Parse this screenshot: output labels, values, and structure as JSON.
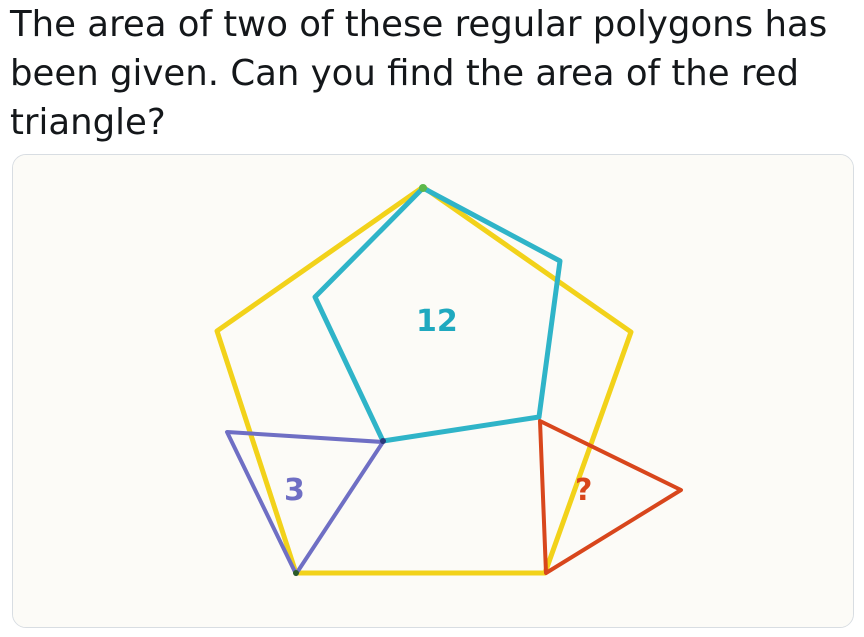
{
  "tweet": {
    "lines": [
      "The area of two of these regular polygons has",
      "been given. Can you find the area of the red",
      "triangle?"
    ]
  },
  "figure": {
    "labels": {
      "pentagon_area": "12",
      "blue_triangle_area": "3",
      "red_triangle_area": "?"
    },
    "colors": {
      "yellow_pentagon": "#f2d21a",
      "teal_pentagon": "#2fb4c8",
      "blue_triangle": "#6f6fc4",
      "red_triangle": "#d8461c",
      "paper": "#fcfbf7"
    }
  }
}
